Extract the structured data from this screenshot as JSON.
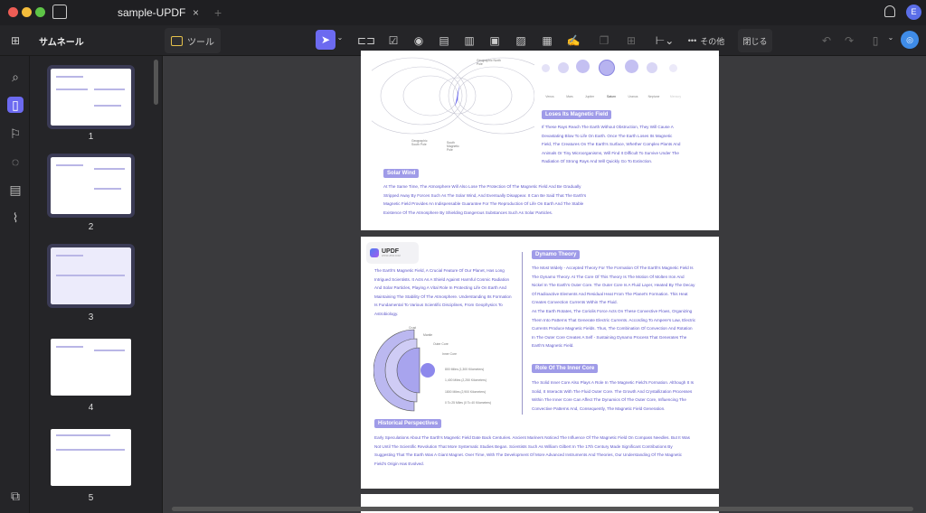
{
  "titlebar": {
    "tab_title": "sample-UPDF",
    "close": "×",
    "new_tab": "+",
    "avatar_initial": "E"
  },
  "toolbar": {
    "panel_title": "サムネール",
    "tools_label": "ツール",
    "more_label": "その他",
    "close_label": "閉じる",
    "more_icon": "•••"
  },
  "thumbnails": [
    {
      "num": "1"
    },
    {
      "num": "2"
    },
    {
      "num": "3"
    },
    {
      "num": "4"
    },
    {
      "num": "5"
    }
  ],
  "page1": {
    "planets": [
      "Venus",
      "Mars",
      "Jupiter",
      "Saturn",
      "Uranus",
      "Neptune",
      "Mercury"
    ],
    "diagram_labels": {
      "north": "Geographic North Pole",
      "south_geo": "Geographic South Pole",
      "south_mag": "South Magnetic Pole",
      "mag": "Magnetic Pole"
    },
    "loses_title": "Loses Its Magnetic Field",
    "loses_text": "If These Rays Reach The Earth Without Obstruction, They Will Cause A Devastating Blow To Life On Earth. Once The Earth Loses Its Magnetic Field, The Creatures On The Earth's Surface, Whether Complex Plants And Animals Or Tiny Microorganisms, Will Find It Difficult To Survive Under The Radiation Of Strong Rays And Will Quickly Go To Extinction.",
    "solar_title": "Solar Wind",
    "solar_text": "At The Same Time, The Atmosphere Will Also Lose The Protection Of The Magnetic Field And Be Gradually Stripped Away By Forces Such As The Solar Wind, And Eventually Disappear. It Can Be Said That The Earth's Magnetic Field Provides An Indispensable Guarantee For The Reproduction Of Life On Earth And The Stable Existence Of The Atmosphere By Shielding Dangerous Substances Such As Solar Particles."
  },
  "page2": {
    "logo": "UPDF",
    "logo_sub": "WWW.UPDF.COM",
    "intro": "The Earth's Magnetic Field, A Crucial Feature Of Our Planet, Has Long Intrigued Scientists. It Acts As A Shield Against Harmful Cosmic Radiation And Solar Particles, Playing A Vital Role In Protecting Life On Earth And Maintaining The Stability Of The Atmosphere. Understanding Its Formation Is Fundamental To Various Scientific Disciplines, From Geophysics To Astrobiology.",
    "layers": [
      "Crust",
      "Mantle",
      "Outer Core",
      "Inner Core"
    ],
    "depths": [
      "800 Miles (1,300 Kilometers)",
      "1,400 Miles (2,250 Kilometers)",
      "1800 Miles (2,900 Kilometers)",
      "0 To 25 Miles (0 To 40 Kilometers)"
    ],
    "dynamo_title": "Dynamo Theory",
    "dynamo_text": "The Most Widely - Accepted Theory For The Formation Of The Earth's Magnetic Field Is The Dynamo Theory. At The Core Of This Theory Is The Motion Of Molten Iron And Nickel In The Earth's Outer Core. The Outer Core Is A Fluid Layer, Heated By The Decay Of Radioactive Elements And Residual Heat From The Planet's Formation. This Heat Creates Convection Currents Within The Fluid.",
    "dynamo_text2": "As The Earth Rotates, The Coriolis Force Acts On These Convective Flows, Organizing Them Into Patterns That Generate Electric Currents. According To Ampere's Law, Electric Currents Produce Magnetic Fields. Thus, The Combination Of Convection And Rotation In The Outer Core Creates A Self - Sustaining Dynamo Process That Generates The Earth's Magnetic Field.",
    "inner_title": "Role Of The Inner Core",
    "inner_text": "The Solid Inner Core Also Plays A Role In The Magnetic Field's Formation. Although It Is Solid, It Interacts With The Fluid Outer Core. The Growth And Crystallization Processes Within The Inner Core Can Affect The Dynamics Of The Outer Core, Influencing The Convective Patterns And, Consequently, The Magnetic Field Generation.",
    "hist_title": "Historical Perspectives",
    "hist_text": "Early Speculations About The Earth's Magnetic Field Date Back Centuries. Ancient Mariners Noticed The Influence Of The Magnetic Field On Compass Needles. But It Was Not Until The Scientific Revolution That More Systematic Studies Began. Scientists Such As William Gilbert In The 17th Century Made Significant Contributions By Suggesting That The Earth Was A Giant Magnet. Over Time, With The Development Of More Advanced Instruments And Theories, Our Understanding Of The Magnetic Field's Origin Has Evolved."
  },
  "colors": {
    "accent": "#6c6af0",
    "highlight": "#9f9be8",
    "text": "#5a54c9"
  }
}
